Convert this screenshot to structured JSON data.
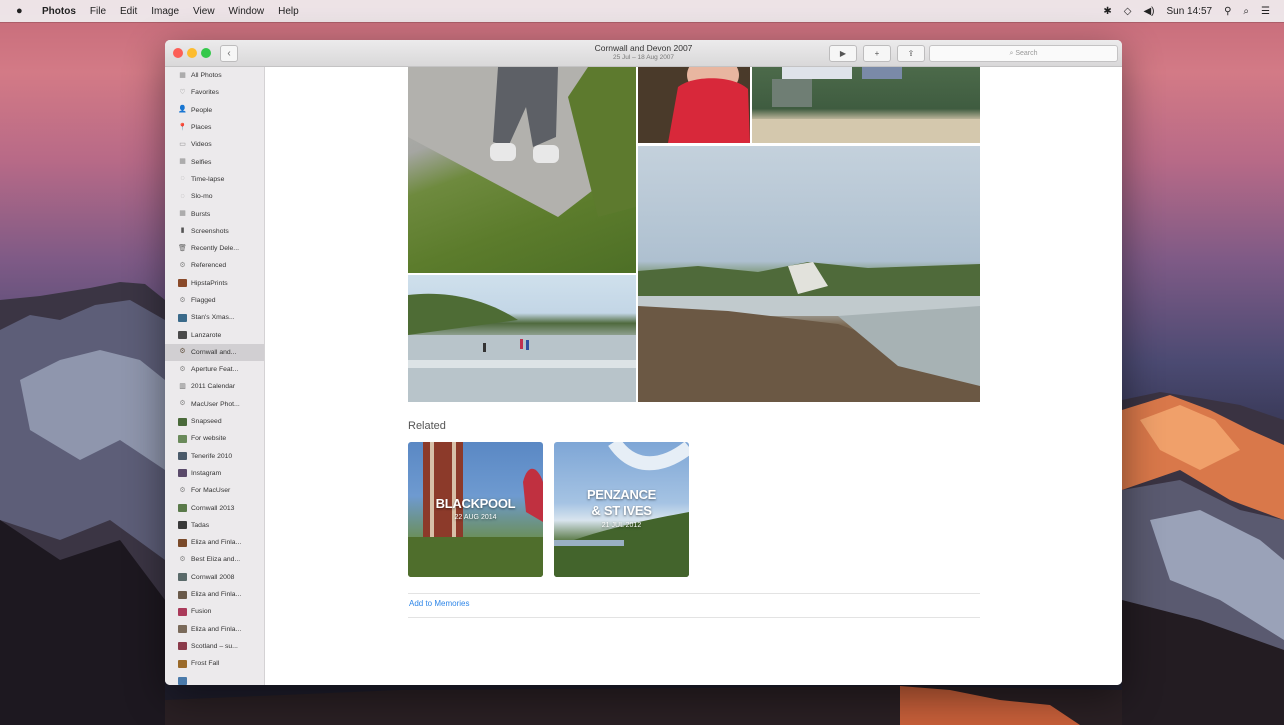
{
  "menubar": {
    "apple": "",
    "items": [
      "Photos",
      "File",
      "Edit",
      "Image",
      "View",
      "Window",
      "Help"
    ],
    "clock": "Sun 14:57"
  },
  "window": {
    "title": "Cornwall and Devon 2007",
    "subtitle": "25 Jul – 18 Aug 2007",
    "search_placeholder": "Search",
    "back": "‹",
    "play": "▶",
    "add": "+",
    "share": "⇪"
  },
  "sidebar": {
    "items": [
      {
        "label": "All Photos",
        "icon": "all-photos-icon",
        "glyph": "▦",
        "color": "#8a8a8a"
      },
      {
        "label": "Favorites",
        "icon": "heart-icon",
        "glyph": "♡",
        "color": "#8a8a8a"
      },
      {
        "label": "People",
        "icon": "person-icon",
        "glyph": "👤",
        "color": "#555555"
      },
      {
        "label": "Places",
        "icon": "pin-icon",
        "glyph": "📍",
        "color": "#666666"
      },
      {
        "label": "Videos",
        "icon": "video-icon",
        "glyph": "▭",
        "color": "#8a8a8a"
      },
      {
        "label": "Selfies",
        "icon": "selfie-icon",
        "glyph": "▦",
        "color": "#8a8a8a"
      },
      {
        "label": "Time-lapse",
        "icon": "timelapse-icon",
        "glyph": "◌",
        "color": "#8a8a8a"
      },
      {
        "label": "Slo-mo",
        "icon": "slomo-icon",
        "glyph": "◌",
        "color": "#8a8a8a"
      },
      {
        "label": "Bursts",
        "icon": "bursts-icon",
        "glyph": "▦",
        "color": "#8a8a8a"
      },
      {
        "label": "Screenshots",
        "icon": "screenshot-icon",
        "glyph": "▮",
        "color": "#555555"
      },
      {
        "label": "Recently Dele...",
        "icon": "trash-icon",
        "glyph": "🗑",
        "color": "#666666"
      },
      {
        "label": "Referenced",
        "icon": "smart-album-icon",
        "glyph": "⚙",
        "color": "#8a8a8a"
      },
      {
        "label": "HipstaPrints",
        "icon": "album-thumb-icon",
        "glyph": "",
        "color": "#8a4a2a"
      },
      {
        "label": "Flagged",
        "icon": "smart-album-icon",
        "glyph": "⚙",
        "color": "#8a8a8a"
      },
      {
        "label": "Stan's Xmas...",
        "icon": "album-thumb-icon",
        "glyph": "",
        "color": "#3a6a8a"
      },
      {
        "label": "Lanzarote",
        "icon": "album-thumb-icon",
        "glyph": "",
        "color": "#4a4a4a"
      },
      {
        "label": "Cornwall and...",
        "icon": "smart-album-icon",
        "glyph": "⚙",
        "color": "#6a5a4a"
      },
      {
        "label": "Aperture Feat...",
        "icon": "smart-album-icon",
        "glyph": "⚙",
        "color": "#8a8a8a"
      },
      {
        "label": "2011 Calendar",
        "icon": "calendar-icon",
        "glyph": "▥",
        "color": "#666666"
      },
      {
        "label": "MacUser Phot...",
        "icon": "smart-album-icon",
        "glyph": "⚙",
        "color": "#8a8a8a"
      },
      {
        "label": "Snapseed",
        "icon": "album-thumb-icon",
        "glyph": "",
        "color": "#4a6a3a"
      },
      {
        "label": "For website",
        "icon": "album-thumb-icon",
        "glyph": "",
        "color": "#6a8a5a"
      },
      {
        "label": "Tenerife 2010",
        "icon": "album-thumb-icon",
        "glyph": "",
        "color": "#4a5a6a"
      },
      {
        "label": "Instagram",
        "icon": "album-thumb-icon",
        "glyph": "",
        "color": "#5a4a6a"
      },
      {
        "label": "For MacUser",
        "icon": "smart-album-icon",
        "glyph": "⚙",
        "color": "#8a8a8a"
      },
      {
        "label": "Cornwall 2013",
        "icon": "album-thumb-icon",
        "glyph": "",
        "color": "#5a7a4a"
      },
      {
        "label": "Tadas",
        "icon": "album-thumb-icon",
        "glyph": "",
        "color": "#3a3a3a"
      },
      {
        "label": "Eliza and Finla...",
        "icon": "album-thumb-icon",
        "glyph": "",
        "color": "#7a4a2a"
      },
      {
        "label": "Best Eliza and...",
        "icon": "smart-album-icon",
        "glyph": "⚙",
        "color": "#8a8a8a"
      },
      {
        "label": "Cornwall 2008",
        "icon": "album-thumb-icon",
        "glyph": "",
        "color": "#5a6a6a"
      },
      {
        "label": "Eliza and Finla...",
        "icon": "album-thumb-icon",
        "glyph": "",
        "color": "#6a5a4a"
      },
      {
        "label": "Fusion",
        "icon": "album-thumb-icon",
        "glyph": "",
        "color": "#aa3a5a"
      },
      {
        "label": "Eliza and Finla...",
        "icon": "album-thumb-icon",
        "glyph": "",
        "color": "#7a6a5a"
      },
      {
        "label": "Scotland – su...",
        "icon": "album-thumb-icon",
        "glyph": "",
        "color": "#8a3a4a"
      },
      {
        "label": "Frost Fall",
        "icon": "album-thumb-icon",
        "glyph": "",
        "color": "#9a6a2a"
      },
      {
        "label": "",
        "icon": "album-thumb-icon",
        "glyph": "",
        "color": "#4a7aaa"
      }
    ],
    "selected_index": 16
  },
  "related": {
    "heading": "Related",
    "memories": [
      {
        "title": "BLACKPOOL",
        "date": "22 AUG 2014"
      },
      {
        "title_line1": "PENZANCE",
        "title_line2": "& ST IVES",
        "date": "21 JUL 2012"
      }
    ],
    "add_link": "Add to Memories"
  }
}
